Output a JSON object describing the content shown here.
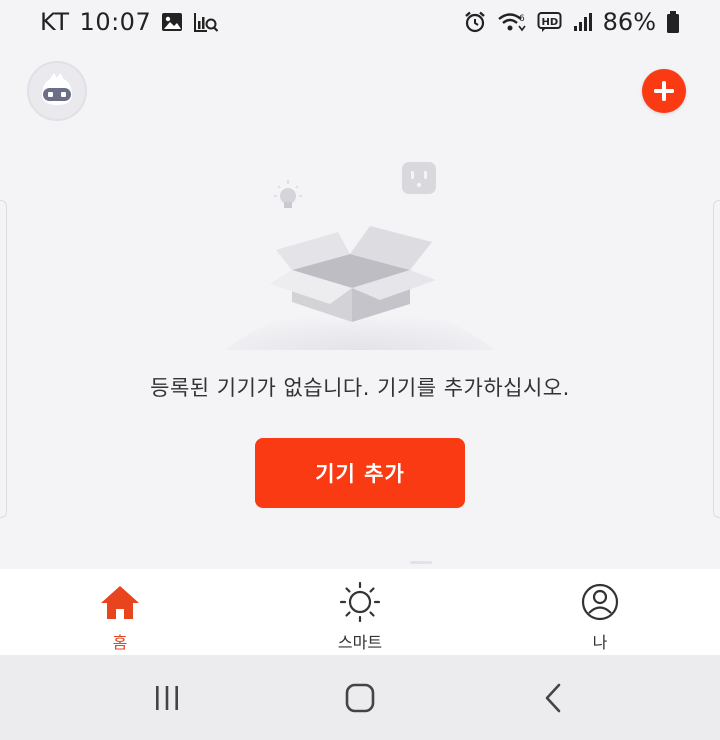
{
  "status_bar": {
    "carrier": "KT",
    "time": "10:07",
    "signal_tech": "6",
    "hd_label": "HD",
    "battery": "86%"
  },
  "header": {
    "avatar_icon": "robot-avatar-icon",
    "add_icon": "plus-icon",
    "accent_color": "#fa3a12"
  },
  "empty_state": {
    "message": "등록된 기기가 없습니다. 기기를 추가하십시오.",
    "button_label": "기기 추가"
  },
  "bottom_nav": {
    "items": [
      {
        "label": "홈",
        "icon": "home-icon",
        "active": true
      },
      {
        "label": "스마트",
        "icon": "sun-icon",
        "active": false
      },
      {
        "label": "나",
        "icon": "person-icon",
        "active": false
      }
    ]
  },
  "system_nav": {
    "recent": "recent-apps-icon",
    "home": "home-button-icon",
    "back": "back-icon"
  }
}
